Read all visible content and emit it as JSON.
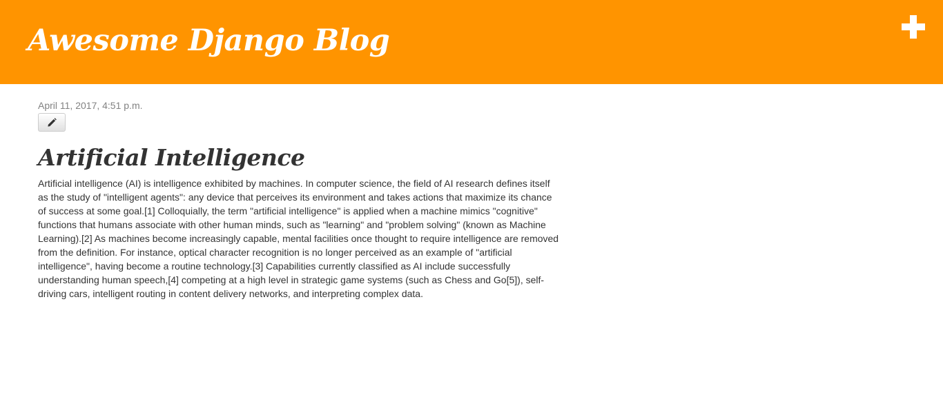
{
  "header": {
    "site_title": "Awesome Django Blog",
    "background_color": "#ff9400",
    "add_icon": "plus-icon"
  },
  "post": {
    "date": "April 11, 2017, 4:51 p.m.",
    "edit_icon": "pencil-icon",
    "title": "Artificial Intelligence",
    "body": "Artificial intelligence (AI) is intelligence exhibited by machines. In computer science, the field of AI research defines itself as the study of \"intelligent agents\": any device that perceives its environment and takes actions that maximize its chance of success at some goal.[1] Colloquially, the term \"artificial intelligence\" is applied when a machine mimics \"cognitive\" functions that humans associate with other human minds, such as \"learning\" and \"problem solving\" (known as Machine Learning).[2] As machines become increasingly capable, mental facilities once thought to require intelligence are removed from the definition. For instance, optical character recognition is no longer perceived as an example of \"artificial intelligence\", having become a routine technology.[3] Capabilities currently classified as AI include successfully understanding human speech,[4] competing at a high level in strategic game systems (such as Chess and Go[5]), self-driving cars, intelligent routing in content delivery networks, and interpreting complex data."
  }
}
